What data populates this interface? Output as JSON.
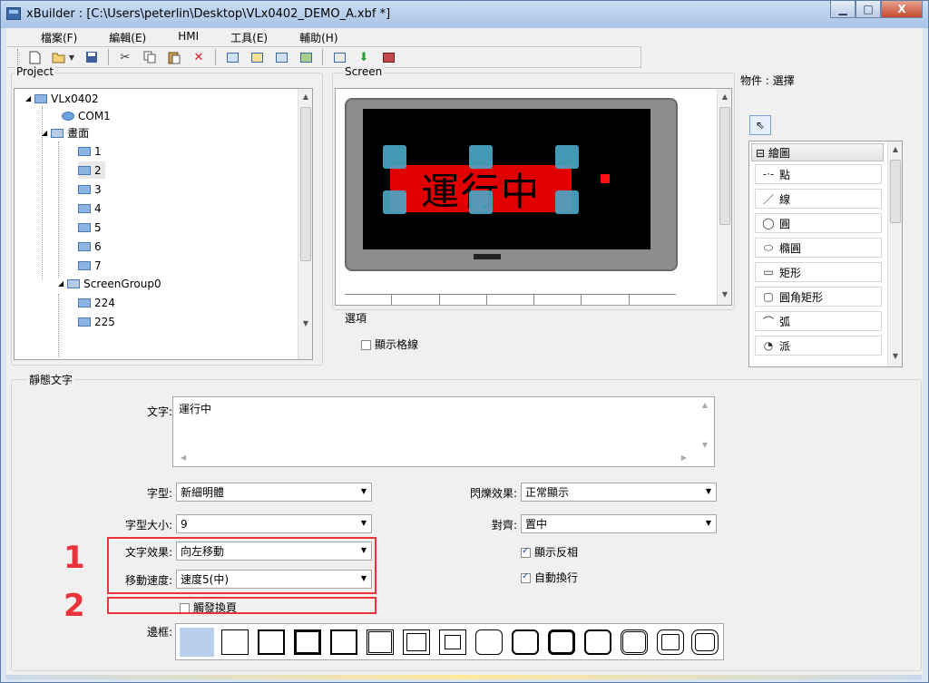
{
  "window": {
    "title": "xBuilder : [C:\\Users\\peterlin\\Desktop\\VLx0402_DEMO_A.xbf *]",
    "minimize": "▁",
    "maximize": "□",
    "close": "X"
  },
  "menu": [
    "檔案(F)",
    "編輯(E)",
    "HMI",
    "工具(E)",
    "輔助(H)"
  ],
  "toolbar": {
    "icons": [
      "new-file-icon",
      "open-icon",
      "dropdown-icon",
      "save-icon",
      "cut-icon",
      "copy-icon",
      "paste-icon",
      "delete-icon",
      "tool-a-icon",
      "tool-b-icon",
      "tool-c-icon",
      "tool-d-icon",
      "screen-icon",
      "download-icon",
      "transfer-icon"
    ],
    "delete_glyph": "✕"
  },
  "project": {
    "label": "Project",
    "nodes": [
      {
        "text": "VLx0402",
        "level": 0
      },
      {
        "text": "COM1",
        "level": 1
      },
      {
        "text": "畫面",
        "level": 1
      },
      {
        "text": "1",
        "level": 2
      },
      {
        "text": "2",
        "level": 2
      },
      {
        "text": "3",
        "level": 2
      },
      {
        "text": "4",
        "level": 2
      },
      {
        "text": "5",
        "level": 2
      },
      {
        "text": "6",
        "level": 2
      },
      {
        "text": "7",
        "level": 2
      },
      {
        "text": "ScreenGroup0",
        "level": 1
      },
      {
        "text": "224",
        "level": 2
      },
      {
        "text": "225",
        "level": 2
      }
    ]
  },
  "screen": {
    "label": "Screen",
    "banner_text": "運行中"
  },
  "options": {
    "label": "選項",
    "show_grid": "顯示格線"
  },
  "palette": {
    "header": "物件 : 選擇",
    "category": "⊟ 繪圖",
    "items": [
      {
        "icon": "-·-",
        "label": "點",
        "icon_name": "point-icon"
      },
      {
        "icon": "／",
        "label": "線",
        "icon_name": "line-icon"
      },
      {
        "icon": "◯",
        "label": "圓",
        "icon_name": "circle-icon"
      },
      {
        "icon": "⬭",
        "label": "橢圓",
        "icon_name": "ellipse-icon"
      },
      {
        "icon": "▭",
        "label": "矩形",
        "icon_name": "rectangle-icon"
      },
      {
        "icon": "▢",
        "label": "圓角矩形",
        "icon_name": "rounded-rect-icon"
      },
      {
        "icon": "⌒",
        "label": "弧",
        "icon_name": "arc-icon"
      },
      {
        "icon": "◔",
        "label": "派",
        "icon_name": "pie-icon"
      }
    ]
  },
  "static_text": {
    "section_label": "靜態文字",
    "text_label": "文字:",
    "text_value": "運行中",
    "font_label": "字型:",
    "font_value": "新細明體",
    "font_size_label": "字型大小:",
    "font_size_value": "9",
    "text_effect_label": "文字效果:",
    "text_effect_value": "向左移動",
    "move_speed_label": "移動速度:",
    "move_speed_value": "速度5(中)",
    "trigger_label": "觸發換頁",
    "blink_label": "閃爍效果:",
    "blink_value": "正常顯示",
    "align_label": "對齊:",
    "align_value": "置中",
    "invert_label": "顯示反相",
    "wrap_label": "自動換行",
    "border_label": "邊框:"
  },
  "annotations": {
    "one": "1",
    "two": "2"
  },
  "colors": {
    "accent_red": "#e8343a",
    "lcd_bg": "#000000",
    "banner_red": "#e00000"
  }
}
